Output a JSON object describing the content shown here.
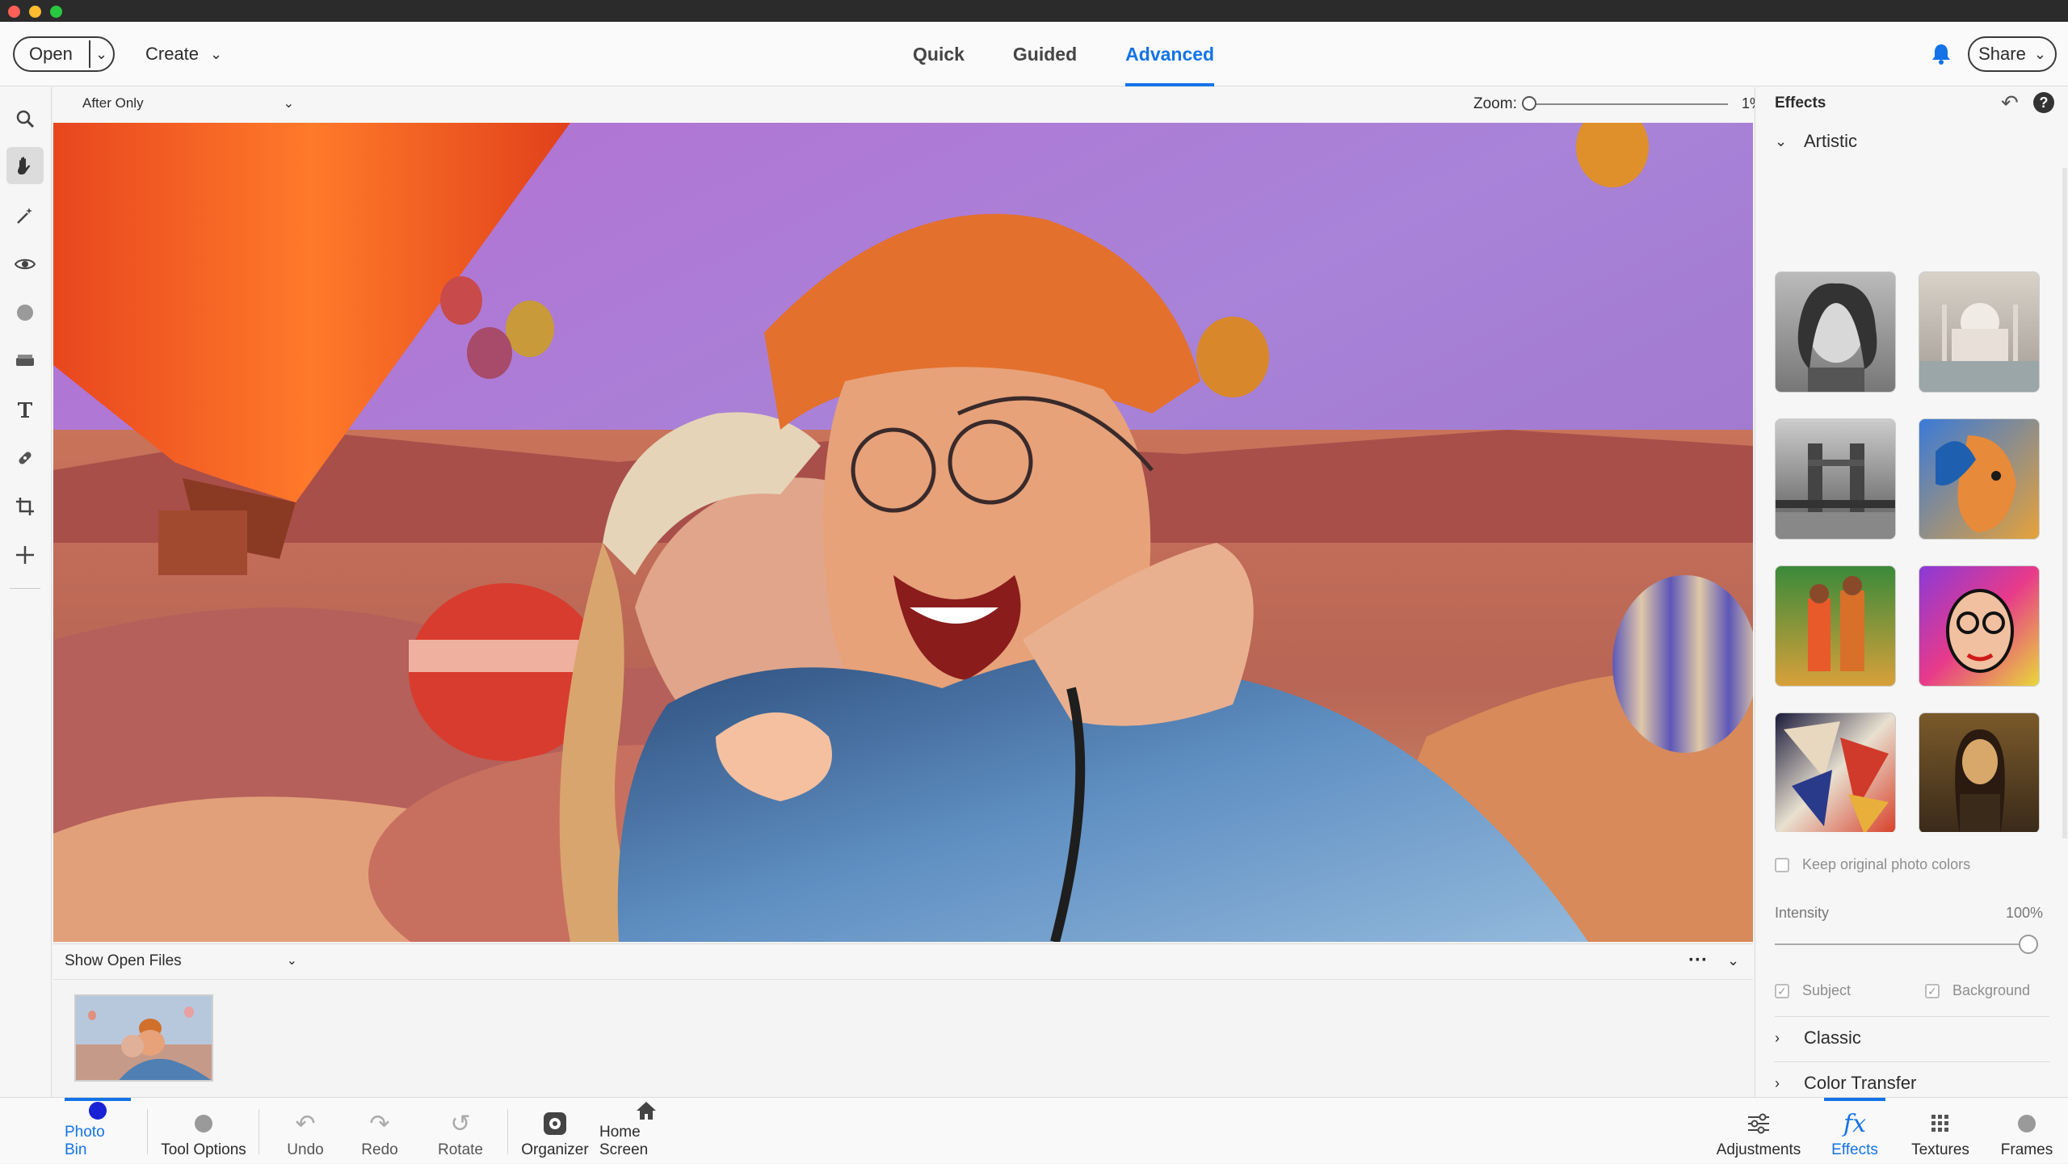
{
  "topbar": {
    "open_label": "Open",
    "create_label": "Create",
    "modes": [
      {
        "label": "Quick"
      },
      {
        "label": "Guided"
      },
      {
        "label": "Advanced"
      }
    ],
    "share_label": "Share"
  },
  "options": {
    "view_mode": "After Only",
    "zoom_label": "Zoom:",
    "zoom_value": "1%",
    "zoom_level_fraction": 0.01
  },
  "files": {
    "show_label": "Show Open Files"
  },
  "panel": {
    "title": "Effects",
    "sections": {
      "artistic": "Artistic",
      "classic": "Classic",
      "color_transfer": "Color Transfer"
    },
    "keep_colors_label": "Keep original photo colors",
    "intensity_label": "Intensity",
    "intensity_value": "100%",
    "subject_label": "Subject",
    "background_label": "Background"
  },
  "taskbar": {
    "photo_bin": "Photo Bin",
    "tool_options": "Tool Options",
    "undo": "Undo",
    "redo": "Redo",
    "rotate": "Rotate",
    "organizer": "Organizer",
    "home_screen": "Home Screen",
    "adjustments": "Adjustments",
    "effects": "Effects",
    "textures": "Textures",
    "frames": "Frames"
  },
  "colors": {
    "accent": "#1473e6",
    "photo_bin_dot": "#1a22d6"
  }
}
